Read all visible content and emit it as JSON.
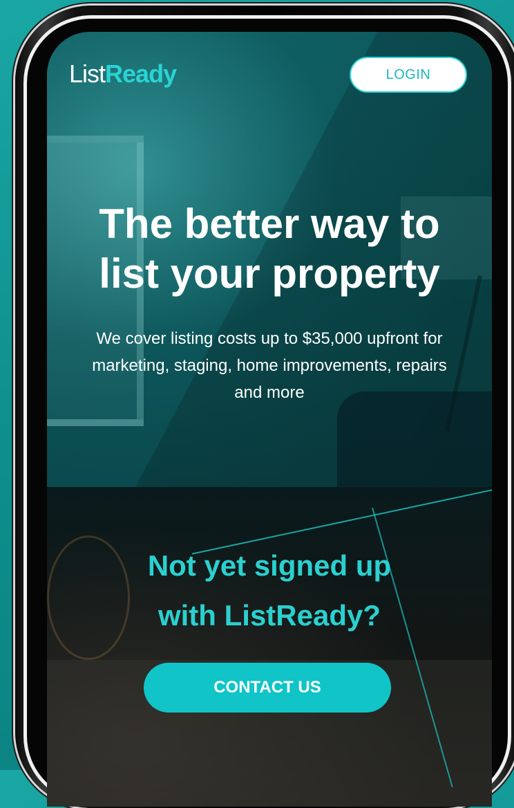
{
  "brand": {
    "logo_primary": "List",
    "logo_accent": "Ready",
    "accent_color": "#2ad3d3",
    "button_color": "#10c4c8"
  },
  "header": {
    "login_label": "LOGIN"
  },
  "hero": {
    "headline_line1": "The better way to",
    "headline_line2": "list your property",
    "subtext": "We cover listing costs up to $35,000 upfront for marketing, staging, home improvements, repairs and more"
  },
  "cta": {
    "title_line1": "Not yet signed up",
    "title_line2": "with ListReady?",
    "button_label": "CONTACT US"
  }
}
